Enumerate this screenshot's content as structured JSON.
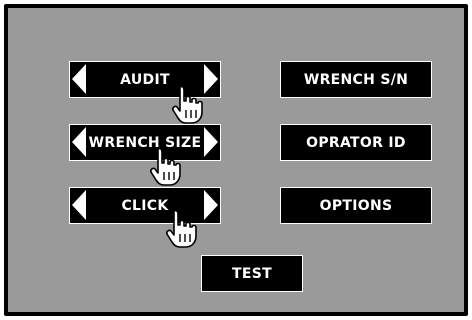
{
  "buttons": {
    "audit": "AUDIT",
    "wrench_size": "WRENCH SIZE",
    "click": "CLICK",
    "wrench_sn": "WRENCH S/N",
    "operator_id": "OPRATOR ID",
    "options": "OPTIONS",
    "test": "TEST"
  },
  "icons": {
    "left_arrow": "triangle-left-icon",
    "right_arrow": "triangle-right-icon",
    "cursor": "hand-pointer-icon"
  },
  "colors": {
    "background": "#9a9a9a",
    "button": "#000000",
    "button_text": "#ffffff",
    "frame": "#000000"
  }
}
